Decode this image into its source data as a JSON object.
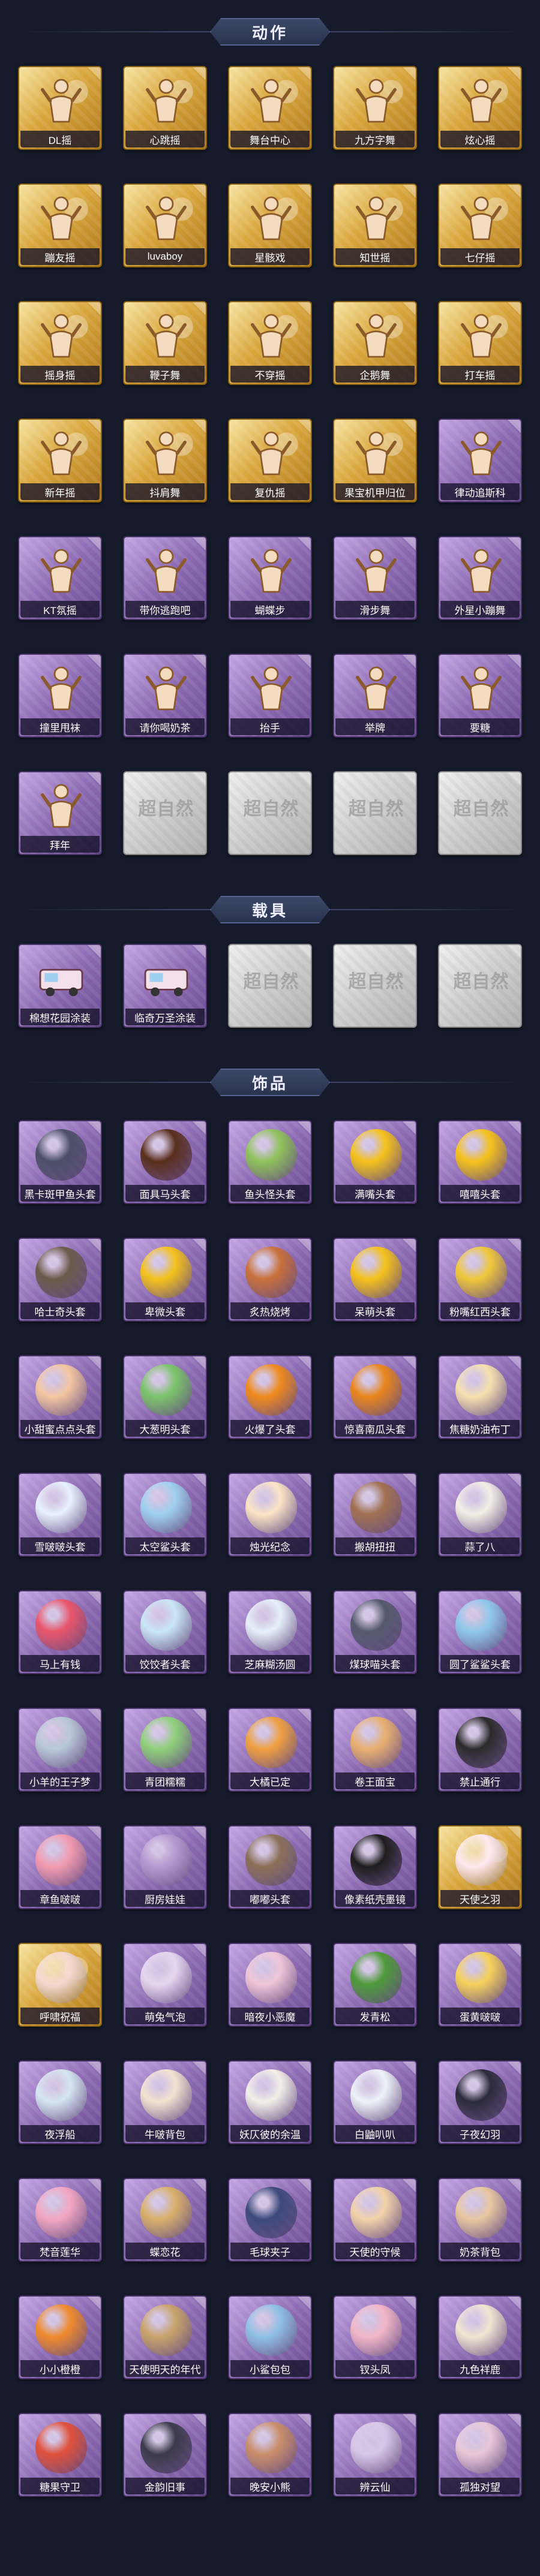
{
  "sections": {
    "actions": {
      "title": "动作",
      "watermark": "超自然",
      "items": [
        {
          "label": "DL摇",
          "style": "gold"
        },
        {
          "label": "心跳摇",
          "style": "gold"
        },
        {
          "label": "舞台中心",
          "style": "gold"
        },
        {
          "label": "九方字舞",
          "style": "gold"
        },
        {
          "label": "炫心摇",
          "style": "gold"
        },
        {
          "label": "蹦友摇",
          "style": "gold"
        },
        {
          "label": "luvaboy",
          "style": "gold"
        },
        {
          "label": "星骸戏",
          "style": "gold"
        },
        {
          "label": "知世摇",
          "style": "gold"
        },
        {
          "label": "七仔摇",
          "style": "gold"
        },
        {
          "label": "摇身摇",
          "style": "gold"
        },
        {
          "label": "鞭子舞",
          "style": "gold"
        },
        {
          "label": "不穿摇",
          "style": "gold"
        },
        {
          "label": "企鹅舞",
          "style": "gold"
        },
        {
          "label": "打车摇",
          "style": "gold"
        },
        {
          "label": "新年摇",
          "style": "gold"
        },
        {
          "label": "抖肩舞",
          "style": "gold"
        },
        {
          "label": "复仇摇",
          "style": "gold"
        },
        {
          "label": "果宝机甲归位",
          "style": "gold"
        },
        {
          "label": "律动追斯科",
          "style": "purple"
        },
        {
          "label": "KT氛摇",
          "style": "purple"
        },
        {
          "label": "带你逃跑吧",
          "style": "purple"
        },
        {
          "label": "蝴蝶步",
          "style": "purple"
        },
        {
          "label": "滑步舞",
          "style": "purple"
        },
        {
          "label": "外星小蹦舞",
          "style": "purple"
        },
        {
          "label": "撞里甩袜",
          "style": "purple"
        },
        {
          "label": "请你喝奶茶",
          "style": "purple"
        },
        {
          "label": "抬手",
          "style": "purple"
        },
        {
          "label": "举牌",
          "style": "purple"
        },
        {
          "label": "要糖",
          "style": "purple"
        },
        {
          "label": "拜年",
          "style": "purple"
        },
        {
          "label": "",
          "style": "locked"
        },
        {
          "label": "",
          "style": "locked"
        },
        {
          "label": "",
          "style": "locked"
        },
        {
          "label": "",
          "style": "locked"
        }
      ]
    },
    "vehicles": {
      "title": "载具",
      "watermark": "超自然",
      "items": [
        {
          "label": "棉想花园涂装",
          "style": "purple"
        },
        {
          "label": "临奇万圣涂装",
          "style": "purple"
        },
        {
          "label": "",
          "style": "locked"
        },
        {
          "label": "",
          "style": "locked"
        },
        {
          "label": "",
          "style": "locked"
        }
      ]
    },
    "accessories": {
      "title": "饰品",
      "items": [
        {
          "label": "黑卡斑甲鱼头套",
          "style": "purple",
          "color": "#4a4f66"
        },
        {
          "label": "面具马头套",
          "style": "purple",
          "color": "#5a2e1c"
        },
        {
          "label": "鱼头怪头套",
          "style": "purple",
          "color": "#8fc25a"
        },
        {
          "label": "满嘴头套",
          "style": "purple",
          "color": "#f5c21b"
        },
        {
          "label": "嘻嘻头套",
          "style": "purple",
          "color": "#f5c21b"
        },
        {
          "label": "哈士奇头套",
          "style": "purple",
          "color": "#6b5a4a"
        },
        {
          "label": "卑微头套",
          "style": "purple",
          "color": "#f5c21b"
        },
        {
          "label": "炙热烧烤",
          "style": "purple",
          "color": "#c9703a"
        },
        {
          "label": "呆萌头套",
          "style": "purple",
          "color": "#f5c21b"
        },
        {
          "label": "粉嘴红西头套",
          "style": "purple",
          "color": "#f0c83a"
        },
        {
          "label": "小甜蜜点点头套",
          "style": "purple",
          "color": "#f3c6a0"
        },
        {
          "label": "大葱明头套",
          "style": "purple",
          "color": "#7bc46a"
        },
        {
          "label": "火爆了头套",
          "style": "purple",
          "color": "#f08a1c"
        },
        {
          "label": "惊喜南瓜头套",
          "style": "purple",
          "color": "#e9861c"
        },
        {
          "label": "焦糖奶油布丁",
          "style": "purple",
          "color": "#f6e1b0"
        },
        {
          "label": "雪啵啵头套",
          "style": "purple",
          "color": "#e8f2ff"
        },
        {
          "label": "太空鲨头套",
          "style": "purple",
          "color": "#9fd0ef"
        },
        {
          "label": "烛光纪念",
          "style": "purple",
          "color": "#fbe5c6"
        },
        {
          "label": "搬胡扭扭",
          "style": "purple",
          "color": "#a07050"
        },
        {
          "label": "蒜了八",
          "style": "purple",
          "color": "#f4efe6"
        },
        {
          "label": "马上有钱",
          "style": "purple",
          "color": "#e9556b"
        },
        {
          "label": "饺饺者头套",
          "style": "purple",
          "color": "#c9e7f5"
        },
        {
          "label": "芝麻糊汤圆",
          "style": "purple",
          "color": "#e6f1fa"
        },
        {
          "label": "煤球喵头套",
          "style": "purple",
          "color": "#53596c"
        },
        {
          "label": "圆了鲨鲨头套",
          "style": "purple",
          "color": "#8fc8ea"
        },
        {
          "label": "小羊的王子梦",
          "style": "purple",
          "color": "#b9c8d8"
        },
        {
          "label": "青团糯糯",
          "style": "purple",
          "color": "#8fd07a"
        },
        {
          "label": "大橘已定",
          "style": "purple",
          "color": "#f0a040"
        },
        {
          "label": "卷王面宝",
          "style": "purple",
          "color": "#e8b070"
        },
        {
          "label": "禁止通行",
          "style": "purple",
          "color": "#2a2a2a"
        },
        {
          "label": "章鱼啵啵",
          "style": "purple",
          "color": "#f29bb0"
        },
        {
          "label": "厨房娃娃",
          "style": "purple",
          "color": "#b49ad0"
        },
        {
          "label": "嘟嘟头套",
          "style": "purple",
          "color": "#8a7058"
        },
        {
          "label": "像素纸壳墨镜",
          "style": "purple",
          "color": "#1c1c1c"
        },
        {
          "label": "天使之羽",
          "style": "gold",
          "color": "#ffe8ef"
        },
        {
          "label": "呼啸祝福",
          "style": "gold",
          "color": "#f4d9d0"
        },
        {
          "label": "萌兔气泡",
          "style": "purple",
          "color": "#e6d7f0"
        },
        {
          "label": "暗夜小恶魔",
          "style": "purple",
          "color": "#f0c6d8"
        },
        {
          "label": "发青松",
          "style": "purple",
          "color": "#4e9a3a"
        },
        {
          "label": "蛋黄啵啵",
          "style": "purple",
          "color": "#f5d15a"
        },
        {
          "label": "夜浮船",
          "style": "purple",
          "color": "#d6e6f2"
        },
        {
          "label": "牛啵背包",
          "style": "purple",
          "color": "#f2e3d0"
        },
        {
          "label": "妖仄彼的余温",
          "style": "purple",
          "color": "#f4efe8"
        },
        {
          "label": "白鼬叭叭",
          "style": "purple",
          "color": "#eef3f8"
        },
        {
          "label": "子夜幻羽",
          "style": "purple",
          "color": "#2a2a3a"
        },
        {
          "label": "梵音莲华",
          "style": "purple",
          "color": "#f3a7c2"
        },
        {
          "label": "蝶恋花",
          "style": "purple",
          "color": "#d9b06a"
        },
        {
          "label": "毛球夹子",
          "style": "purple",
          "color": "#3c4a7a"
        },
        {
          "label": "天使的守候",
          "style": "purple",
          "color": "#f2d2a8"
        },
        {
          "label": "奶茶背包",
          "style": "purple",
          "color": "#e8c7a0"
        },
        {
          "label": "小小橙橙",
          "style": "purple",
          "color": "#f08a2c"
        },
        {
          "label": "天使明天的年代",
          "style": "purple",
          "color": "#c9a36a"
        },
        {
          "label": "小鲨包包",
          "style": "purple",
          "color": "#8fc0e4"
        },
        {
          "label": "钗头凤",
          "style": "purple",
          "color": "#f2b7c8"
        },
        {
          "label": "九色祥鹿",
          "style": "purple",
          "color": "#f1e6d2"
        },
        {
          "label": "糖果守卫",
          "style": "purple",
          "color": "#e0503a"
        },
        {
          "label": "金韵旧事",
          "style": "purple",
          "color": "#3a3a4a"
        },
        {
          "label": "晚安小熊",
          "style": "purple",
          "color": "#c98e6a"
        },
        {
          "label": "辨云仙",
          "style": "purple",
          "color": "#d6c7e6"
        },
        {
          "label": "孤独对望",
          "style": "purple",
          "color": "#e8c8d8"
        }
      ]
    }
  },
  "colors": {
    "background": "#161b2b",
    "gold_card": "#d8a63c",
    "purple_card": "#8d6bb3",
    "locked_card": "#cfcfcf",
    "label_bg": "#14122b"
  }
}
